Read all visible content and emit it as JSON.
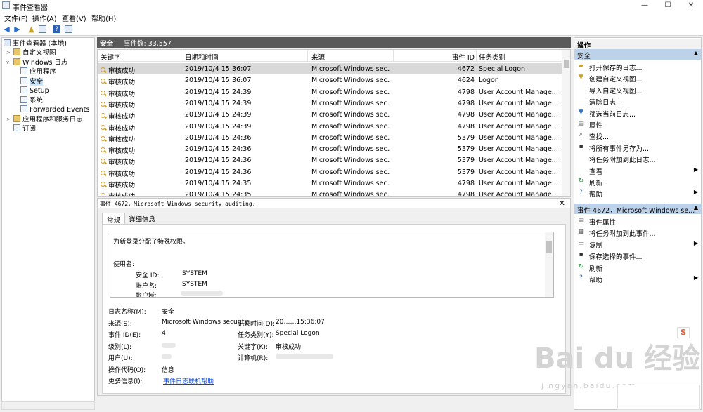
{
  "window": {
    "title": "事件查看器",
    "min": "—",
    "max": "☐",
    "close": "✕"
  },
  "menu": [
    "文件(F)",
    "操作(A)",
    "查看(V)",
    "帮助(H)"
  ],
  "tree": {
    "root": "事件查看器 (本地)",
    "custom_views": "自定义视图",
    "windows_logs": "Windows 日志",
    "children": [
      "应用程序",
      "安全",
      "Setup",
      "系统",
      "Forwarded Events"
    ],
    "app_services": "应用程序和服务日志",
    "subscriptions": "订阅"
  },
  "center": {
    "title": "安全",
    "count_label": "事件数: 33,557"
  },
  "table": {
    "columns": [
      "关键字",
      "日期和时间",
      "来源",
      "事件 ID",
      "任务类别"
    ],
    "rows": [
      [
        "审核成功",
        "2019/10/4 15:36:07",
        "Microsoft Windows sec...",
        "4672",
        "Special Logon"
      ],
      [
        "审核成功",
        "2019/10/4 15:36:07",
        "Microsoft Windows sec...",
        "4624",
        "Logon"
      ],
      [
        "审核成功",
        "2019/10/4 15:24:39",
        "Microsoft Windows sec...",
        "4798",
        "User Account Manage..."
      ],
      [
        "审核成功",
        "2019/10/4 15:24:39",
        "Microsoft Windows sec...",
        "4798",
        "User Account Manage..."
      ],
      [
        "审核成功",
        "2019/10/4 15:24:39",
        "Microsoft Windows sec...",
        "4798",
        "User Account Manage..."
      ],
      [
        "审核成功",
        "2019/10/4 15:24:39",
        "Microsoft Windows sec...",
        "4798",
        "User Account Manage..."
      ],
      [
        "审核成功",
        "2019/10/4 15:24:36",
        "Microsoft Windows sec...",
        "5379",
        "User Account Manage..."
      ],
      [
        "审核成功",
        "2019/10/4 15:24:36",
        "Microsoft Windows sec...",
        "5379",
        "User Account Manage..."
      ],
      [
        "审核成功",
        "2019/10/4 15:24:36",
        "Microsoft Windows sec...",
        "5379",
        "User Account Manage..."
      ],
      [
        "审核成功",
        "2019/10/4 15:24:36",
        "Microsoft Windows sec...",
        "5379",
        "User Account Manage..."
      ],
      [
        "审核成功",
        "2019/10/4 15:24:35",
        "Microsoft Windows sec...",
        "4798",
        "User Account Manage..."
      ],
      [
        "审核成功",
        "2019/10/4 15:24:35",
        "Microsoft Windows sec...",
        "4798",
        "User Account Manage..."
      ]
    ]
  },
  "detail": {
    "title": "事件 4672，Microsoft Windows security auditing.",
    "close": "✕",
    "tabs": [
      "常规",
      "详细信息"
    ],
    "description": [
      "为新登录分配了特殊权限。",
      "使用者:"
    ],
    "desc_fields": [
      [
        "安全 ID:",
        "SYSTEM"
      ],
      [
        "帐户名:",
        "SYSTEM"
      ],
      [
        "帐户域:",
        ""
      ]
    ],
    "props": {
      "log_name_label": "日志名称(M):",
      "log_name": "安全",
      "source_label": "来源(S):",
      "source": "Microsoft Windows security",
      "logged_label": "记录时间(D):",
      "logged": "20……15:36:07",
      "event_id_label": "事件 ID(E):",
      "event_id": "4",
      "task_label": "任务类别(Y):",
      "task": "Special Logon",
      "level_label": "级别(L):",
      "keywords_label": "关键字(K):",
      "keywords": "审核成功",
      "user_label": "用户(U):",
      "computer_label": "计算机(R):",
      "opcode_label": "操作代码(O):",
      "opcode": "信息",
      "more_label": "更多信息(I):",
      "more_link": "事件日志联机帮助"
    }
  },
  "actions": {
    "header": "操作",
    "section1": "安全",
    "items1": [
      "打开保存的日志...",
      "创建自定义视图...",
      "导入自定义视图...",
      "清除日志...",
      "筛选当前日志...",
      "属性",
      "查找...",
      "将所有事件另存为...",
      "将任务附加到此日志...",
      "查看",
      "刷新",
      "帮助"
    ],
    "section2": "事件 4672，Microsoft Windows se...",
    "items2": [
      "事件属性",
      "将任务附加到此事件...",
      "复制",
      "保存选择的事件...",
      "刷新",
      "帮助"
    ]
  },
  "watermark": {
    "main": "Bai du 经验",
    "sub": "jingyan.baidu.com"
  },
  "tray_badge": "S"
}
